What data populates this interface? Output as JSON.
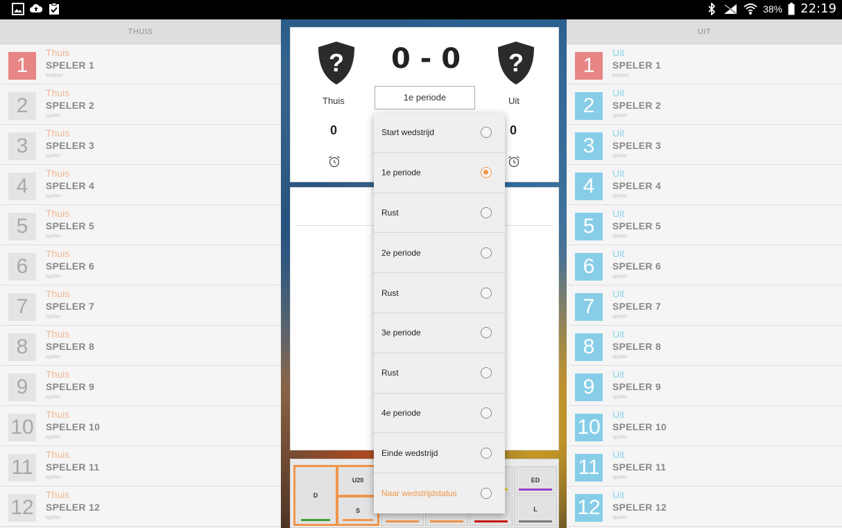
{
  "statusbar": {
    "battery": "38%",
    "time": "22:19"
  },
  "home_column": {
    "header": "THUIS",
    "players": [
      {
        "number": "1",
        "team": "Thuis",
        "name": "SPELER 1",
        "role": "keeper"
      },
      {
        "number": "2",
        "team": "Thuis",
        "name": "SPELER 2",
        "role": "speler"
      },
      {
        "number": "3",
        "team": "Thuis",
        "name": "SPELER 3",
        "role": "speler"
      },
      {
        "number": "4",
        "team": "Thuis",
        "name": "SPELER 4",
        "role": "speler"
      },
      {
        "number": "5",
        "team": "Thuis",
        "name": "SPELER 5",
        "role": "speler"
      },
      {
        "number": "6",
        "team": "Thuis",
        "name": "SPELER 6",
        "role": "speler"
      },
      {
        "number": "7",
        "team": "Thuis",
        "name": "SPELER 7",
        "role": "speler"
      },
      {
        "number": "8",
        "team": "Thuis",
        "name": "SPELER 8",
        "role": "speler"
      },
      {
        "number": "9",
        "team": "Thuis",
        "name": "SPELER 9",
        "role": "speler"
      },
      {
        "number": "10",
        "team": "Thuis",
        "name": "SPELER 10",
        "role": "speler"
      },
      {
        "number": "11",
        "team": "Thuis",
        "name": "SPELER 11",
        "role": "speler"
      },
      {
        "number": "12",
        "team": "Thuis",
        "name": "SPELER 12",
        "role": "speler"
      }
    ]
  },
  "away_column": {
    "header": "UIT",
    "players": [
      {
        "number": "1",
        "team": "Uit",
        "name": "SPELER 1",
        "role": "keeper"
      },
      {
        "number": "2",
        "team": "Uit",
        "name": "SPELER 2",
        "role": "speler"
      },
      {
        "number": "3",
        "team": "Uit",
        "name": "SPELER 3",
        "role": "speler"
      },
      {
        "number": "4",
        "team": "Uit",
        "name": "SPELER 4",
        "role": "speler"
      },
      {
        "number": "5",
        "team": "Uit",
        "name": "SPELER 5",
        "role": "speler"
      },
      {
        "number": "6",
        "team": "Uit",
        "name": "SPELER 6",
        "role": "speler"
      },
      {
        "number": "7",
        "team": "Uit",
        "name": "SPELER 7",
        "role": "speler"
      },
      {
        "number": "8",
        "team": "Uit",
        "name": "SPELER 8",
        "role": "speler"
      },
      {
        "number": "9",
        "team": "Uit",
        "name": "SPELER 9",
        "role": "speler"
      },
      {
        "number": "10",
        "team": "Uit",
        "name": "SPELER 10",
        "role": "speler"
      },
      {
        "number": "11",
        "team": "Uit",
        "name": "SPELER 11",
        "role": "speler"
      },
      {
        "number": "12",
        "team": "Uit",
        "name": "SPELER 12",
        "role": "speler"
      }
    ]
  },
  "scoreboard": {
    "score": "0 - 0",
    "home_label": "Thuis",
    "away_label": "Uit",
    "period": "1e periode",
    "home_goals": "0",
    "away_goals": "0"
  },
  "period_menu": {
    "items": [
      {
        "label": "Start wedstrijd",
        "checked": false
      },
      {
        "label": "1e periode",
        "checked": true
      },
      {
        "label": "Rust",
        "checked": false
      },
      {
        "label": "2e periode",
        "checked": false
      },
      {
        "label": "Rust",
        "checked": false
      },
      {
        "label": "3e periode",
        "checked": false
      },
      {
        "label": "Rust",
        "checked": false
      },
      {
        "label": "4e periode",
        "checked": false
      },
      {
        "label": "Einde wedstrijd",
        "checked": false
      },
      {
        "label": "Naar wedstrijdstatus",
        "checked": false
      }
    ]
  },
  "field_zones": {
    "d": "D",
    "u20": "U20",
    "s": "S",
    "ed": "ED",
    "l": "L"
  },
  "colors": {
    "accent": "#f0954a",
    "home_keeper": "#e88585",
    "away_player": "#87cde8",
    "zone_green": "#3c9a2e",
    "zone_purple": "#9b3fc8",
    "zone_red": "#cc1111",
    "zone_gray": "#777777",
    "zone_yellow": "#e6d21a"
  }
}
